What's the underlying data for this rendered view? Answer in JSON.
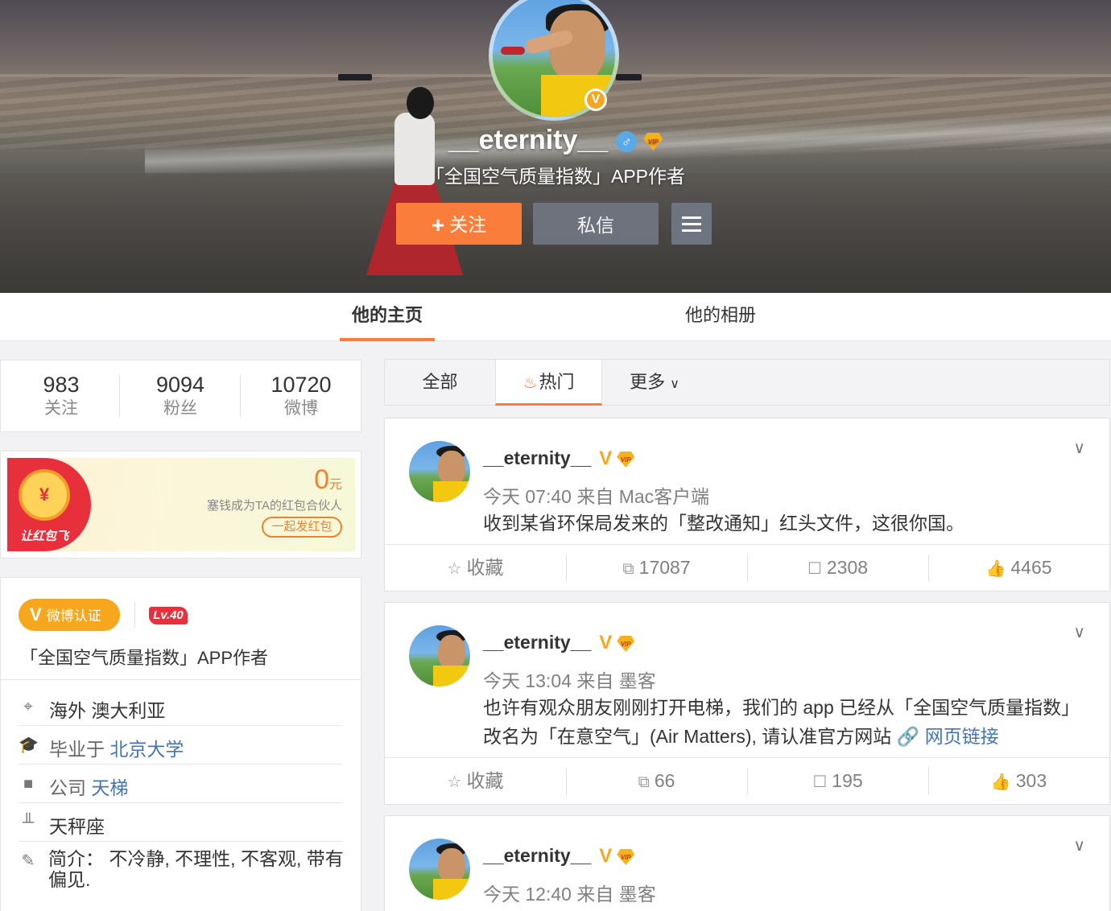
{
  "profile": {
    "name": "__eternity__",
    "gender_icon": "♂",
    "vip_label": "VIP",
    "intro": "「全国空气质量指数」APP作者",
    "follow_label": "关注",
    "message_label": "私信"
  },
  "tabs": {
    "home": "他的主页",
    "album": "他的相册"
  },
  "stats": [
    {
      "num": "983",
      "label": "关注"
    },
    {
      "num": "9094",
      "label": "粉丝"
    },
    {
      "num": "10720",
      "label": "微博"
    }
  ],
  "hongbao": {
    "amount": "0",
    "unit": "元",
    "text": "塞钱成为TA的红包合伙人",
    "button": "一起发红包",
    "logo": "让红包飞",
    "coin": "¥"
  },
  "verify": {
    "pill": "微博认证",
    "level": "Lv.40",
    "text": "「全国空气质量指数」APP作者",
    "location": "海外 澳大利亚",
    "edu_prefix": "毕业于",
    "edu_school": "北京大学",
    "company_prefix": "公司",
    "company_name": "天梯",
    "zodiac": "天秤座",
    "bio": "简介：  不冷静, 不理性, 不客观, 带有偏见."
  },
  "filter": {
    "all": "全部",
    "hot": "热门",
    "more": "更多"
  },
  "posts": [
    {
      "name": "__eternity__",
      "meta": "今天 07:40 来自 Mac客户端",
      "text": "收到某省环保局发来的「整改通知」红头文件，这很你国。",
      "link": "",
      "fav": "收藏",
      "repost": "17087",
      "comment": "2308",
      "like": "4465"
    },
    {
      "name": "__eternity__",
      "meta": "今天 13:04 来自 墨客",
      "text": "也许有观众朋友刚刚打开电梯，我们的 app 已经从「全国空气质量指数」改名为「在意空气」(Air Matters), 请认准官方网站 ",
      "link": "网页链接",
      "fav": "收藏",
      "repost": "66",
      "comment": "195",
      "like": "303"
    },
    {
      "name": "__eternity__",
      "meta": "今天 12:40 来自 墨客"
    }
  ]
}
